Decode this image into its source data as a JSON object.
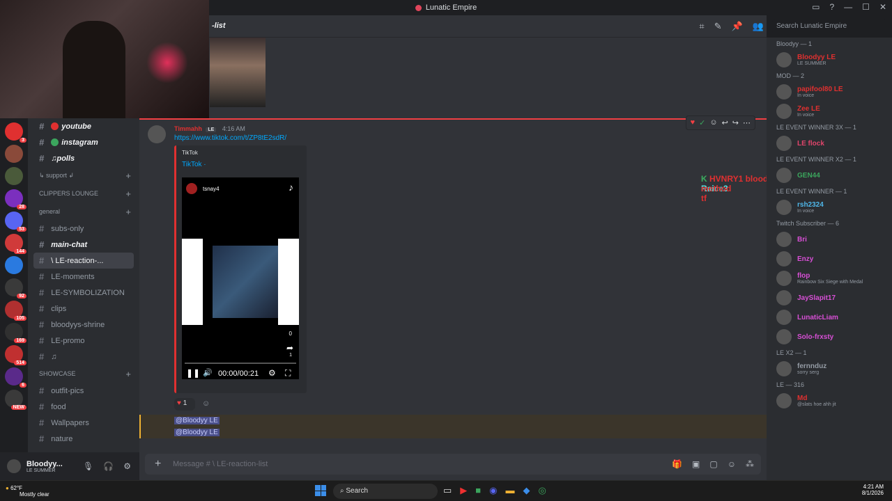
{
  "window": {
    "title": "Lunatic Empire"
  },
  "header": {
    "channel": "-list",
    "search_placeholder": "Search Lunatic Empire"
  },
  "channels": [
    {
      "label": "youtube",
      "emoji_color": "#e03030",
      "bold": true
    },
    {
      "label": "instagram",
      "emoji_color": "#3ba55d",
      "bold": true
    },
    {
      "label": "♫polls",
      "bold": true
    }
  ],
  "categories": {
    "support": "↳ support ↲",
    "clippers": "CLIPPERS LOUNGE",
    "general": "general",
    "showcase": "SHOWCASE"
  },
  "general_channels": [
    {
      "label": "subs-only"
    },
    {
      "label": "main-chat",
      "bold": true
    },
    {
      "label": "\\ LE-reaction-...",
      "selected": true
    },
    {
      "label": "LE-moments"
    },
    {
      "label": "LE-SYMBOLIZATION"
    },
    {
      "label": "clips"
    },
    {
      "label": "bloodyys-shrine"
    },
    {
      "label": "LE-promo"
    },
    {
      "label": "♫"
    }
  ],
  "showcase_channels": [
    {
      "label": "outfit-pics"
    },
    {
      "label": "food"
    },
    {
      "label": "Wallpapers"
    },
    {
      "label": "nature"
    }
  ],
  "servers": [
    {
      "badge": "3"
    },
    {
      "badge": ""
    },
    {
      "badge": ""
    },
    {
      "badge": "28"
    },
    {
      "badge": "53"
    },
    {
      "badge": "144"
    },
    {
      "badge": ""
    },
    {
      "badge": "92"
    },
    {
      "badge": "105"
    },
    {
      "badge": "169"
    },
    {
      "badge": "514"
    },
    {
      "badge": "6"
    },
    {
      "badge": "NEW"
    }
  ],
  "user": {
    "name": "Bloodyy...",
    "status": "LE SUMMER"
  },
  "message": {
    "author": "Timmahh",
    "author_tag": "LE",
    "time": "4:16 AM",
    "link": "https://www.tiktok.com/t/ZP8tE2sdR/",
    "embed_provider": "TikTok",
    "embed_title": "TikTok ·",
    "tiktok_user": "tsnay4",
    "video_time": "00:00/00:21",
    "count_like": "0",
    "count_share": "1",
    "reaction_count": "1"
  },
  "mentions": [
    "@Bloodyy LE",
    "@Bloodyy LE"
  ],
  "overlay": [
    {
      "name": "Raice3",
      "text": "tf"
    },
    {
      "name": "HVNRY1",
      "text": "bloodyy emo to the kamala method"
    }
  ],
  "input_placeholder": "Message # \\ LE-reaction-list",
  "members": {
    "cats": [
      "Bloodyy — 1",
      "MOD — 2",
      "LE EVENT WINNER 3X — 1",
      "LE EVENT WINNER X2 — 1",
      "LE EVENT WINNER — 1",
      "Twitch Subscriber — 6",
      "LE X2 — 1",
      "LE — 316"
    ],
    "list": [
      {
        "cat": 0,
        "name": "Bloodyy LE",
        "status": "LE SUMMER",
        "color": "#e03030"
      },
      {
        "cat": 1,
        "name": "papifool80 LE",
        "status": "In voice",
        "color": "#e03030"
      },
      {
        "cat": 1,
        "name": "Zee LE",
        "status": "In voice",
        "color": "#e03030"
      },
      {
        "cat": 2,
        "name": "LE flock",
        "status": "",
        "color": "#e0456b"
      },
      {
        "cat": 3,
        "name": "GEN44",
        "status": "",
        "color": "#3ba55d"
      },
      {
        "cat": 4,
        "name": "rsh2324",
        "status": "In voice",
        "color": "#4fb6e8"
      },
      {
        "cat": 5,
        "name": "Bri",
        "status": "",
        "color": "#d84fd6"
      },
      {
        "cat": 5,
        "name": "Enzy",
        "status": "",
        "color": "#d84fd6"
      },
      {
        "cat": 5,
        "name": "flop",
        "status": "Rainbow Six Siege with Medal",
        "color": "#d84fd6"
      },
      {
        "cat": 5,
        "name": "JaySlapit17",
        "status": "",
        "color": "#d84fd6"
      },
      {
        "cat": 5,
        "name": "LunaticLiam",
        "status": "",
        "color": "#d84fd6"
      },
      {
        "cat": 5,
        "name": "Solo-frxsty",
        "status": "",
        "color": "#d84fd6"
      },
      {
        "cat": 6,
        "name": "fernnduz",
        "status": "sorry serg",
        "color": "#949ba4"
      },
      {
        "cat": 7,
        "name": "Md",
        "status": "@slats hoe ahh jit",
        "color": "#e03030"
      }
    ]
  },
  "taskbar": {
    "weather_temp": "62°F",
    "weather_desc": "Mostly clear",
    "search": "Search",
    "time": "4:21 AM",
    "date": "8/1/2026"
  }
}
